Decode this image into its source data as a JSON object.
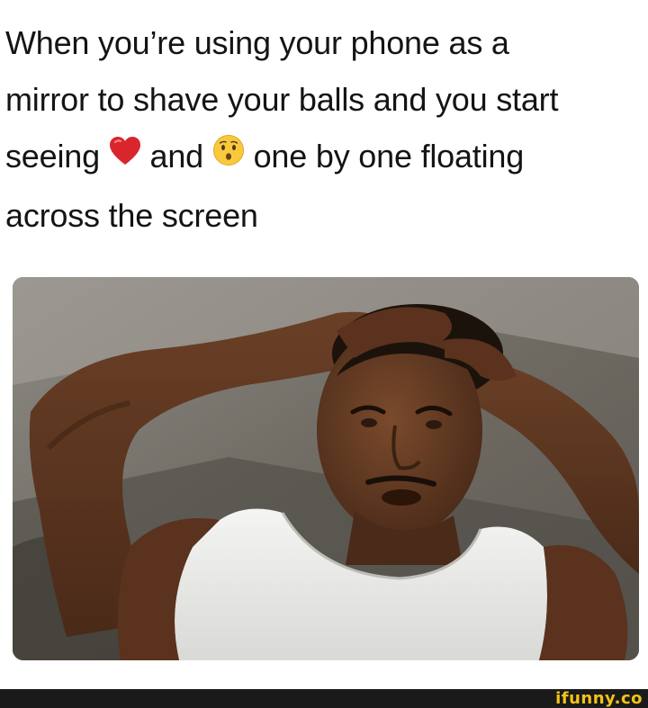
{
  "caption": {
    "line1": "When you’re using your phone as a",
    "line2": "mirror to shave your balls and you start",
    "line3_before": "seeing",
    "line3_middle": "and",
    "line3_after": "one by one floating",
    "line4": "across the screen",
    "emoji_1": "red-heart-icon",
    "emoji_2": "hushed-face-icon"
  },
  "watermark": {
    "text": "ifunny.co",
    "color": "#f2c418"
  }
}
